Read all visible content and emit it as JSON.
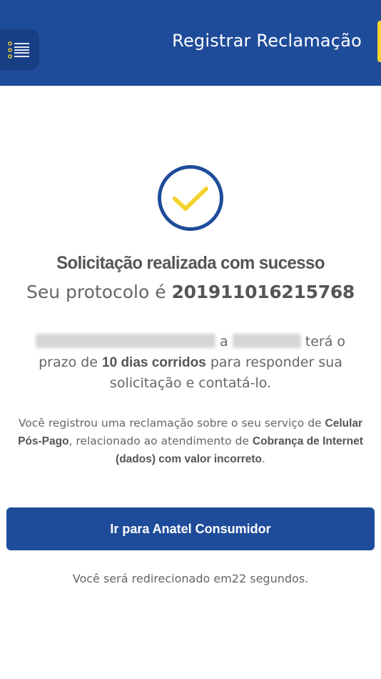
{
  "header": {
    "title": "Registrar Reclamação",
    "menu_icon": "list-menu-icon",
    "background": "#1f4c9a",
    "accent": "#f5d430"
  },
  "status": {
    "icon": "check-circle-icon",
    "headline": "Solicitação realizada com sucesso",
    "protocol_label": "Seu protocolo é",
    "protocol_number": "201911016215768"
  },
  "message": {
    "connector": "a",
    "text_part1": "terá o prazo de",
    "deadline": "10 dias corridos",
    "text_part2": "para responder sua solicitação e contatá-lo."
  },
  "summary": {
    "part1": "Você registrou uma reclamação sobre o seu serviço de",
    "service": "Celular Pós-Pago",
    "part2": ", relacionado ao atendimento de",
    "topic": "Cobrança de Internet (dados) com valor incorreto",
    "part3": "."
  },
  "cta": {
    "label": "Ir para Anatel Consumidor"
  },
  "redirect": {
    "part1": "Você será redirecionado em",
    "seconds": "22",
    "part2": "segundos."
  }
}
